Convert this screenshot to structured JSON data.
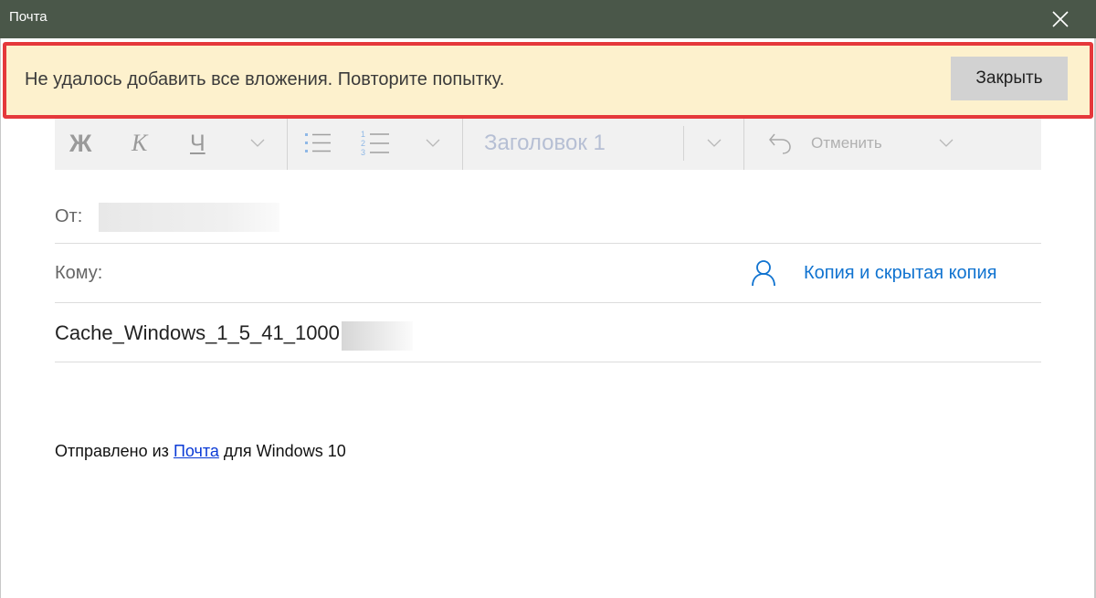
{
  "window": {
    "title": "Почта",
    "close_icon": "close-icon",
    "titlebar_color": "#4a5749"
  },
  "banner": {
    "message": "Не удалось добавить все вложения. Повторите попытку.",
    "close_label": "Закрыть",
    "background": "#fdf1cd",
    "highlight_color": "#e5383b"
  },
  "toolbar": {
    "bold_label": "Ж",
    "italic_label": "К",
    "underline_label": "Ч",
    "heading_label": "Заголовок 1",
    "undo_label": "Отменить",
    "icons": [
      "chevron-down-icon",
      "bullet-list-icon",
      "numbered-list-icon",
      "undo-icon"
    ]
  },
  "compose": {
    "from_label": "От:",
    "to_label": "Кому:",
    "cc_bcc_label": "Копия и скрытая копия",
    "subject": "Cache_Windows_1_5_41_1000",
    "accent_color": "#1073d0"
  },
  "body": {
    "signature_prefix": "Отправлено из ",
    "signature_link": "Почта",
    "signature_suffix": " для Windows 10"
  }
}
